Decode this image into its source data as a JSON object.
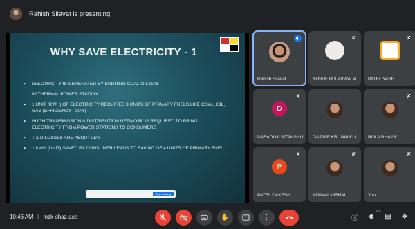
{
  "presenter": {
    "text": "Rahish Silavat is presenting"
  },
  "slide": {
    "title": "WHY SAVE ELECTRICITY - 1",
    "bullets": [
      {
        "type": "bullet",
        "text": "ELECTRICITY IS GENERATED BY BURNING COAL,OIL,GAS"
      },
      {
        "type": "sub",
        "text": "IN THERMAL POWER STATION"
      },
      {
        "type": "bullet",
        "text": "1 UNIT (KWH) OF ELECTRICITY REQUIRES 3 UNITS OF PRIMARY FUELS LIKE COAL, OIL, GAS (EFFICIENCY - 30%)"
      },
      {
        "type": "bullet",
        "text": "HUGH TRANSMISSION & DISTRIBUTION NETWORK IS REQUIRED TO BRING ELECTRICITY FROM POWER STATIONS TO CONSUMERS"
      },
      {
        "type": "bullet",
        "text": "T & D LOSSES ARE ABOUT 25%"
      },
      {
        "type": "bullet",
        "text": "1 KWH (UNIT) SAVED BY CONSUMER LEADS TO SAVING OF 4 UNITS OF PRIMARY FUEL"
      }
    ],
    "caption_button": "Stop sharing"
  },
  "participants": [
    {
      "name": "Rahish Silavat",
      "avatar": "photo",
      "speaking": true
    },
    {
      "name": "YUSUF PULAVWALA",
      "avatar": "photo",
      "mic_off": true
    },
    {
      "name": "PATEL YASH",
      "avatar": "photo",
      "mic_off": true
    },
    {
      "name": "DASADIYA SITANSHU",
      "avatar": "letter",
      "letter": "D",
      "color": "#c2185b",
      "mic_off": true
    },
    {
      "name": "GAJJAR KRUNALKU...",
      "avatar": "photo",
      "mic_off": false
    },
    {
      "name": "ROLA BHAVIK",
      "avatar": "photo",
      "mic_off": true
    },
    {
      "name": "PATEL DAXESH",
      "avatar": "letter",
      "letter": "P",
      "color": "#e64a19",
      "mic_off": true
    },
    {
      "name": "ADIWAL VISHAL",
      "avatar": "photo",
      "mic_off": true
    },
    {
      "name": "You",
      "avatar": "photo",
      "mic_off": true
    }
  ],
  "bottom": {
    "time": "10:46 AM",
    "separator": "|",
    "meeting_code": "mzk-shaz-asa",
    "people_count": "10"
  },
  "icons": {
    "mic_off": "mic-off-icon",
    "cam_off": "camera-off-icon",
    "captions": "captions-icon",
    "raise_hand": "raise-hand-icon",
    "present": "present-icon",
    "more": "more-options-icon",
    "end_call": "end-call-icon",
    "info": "info-icon",
    "people": "people-icon",
    "chat": "chat-icon",
    "activities": "activities-icon"
  },
  "colors": {
    "background": "#202124",
    "tile": "#3c4043",
    "danger": "#ea4335",
    "accent": "#1a73e8"
  }
}
